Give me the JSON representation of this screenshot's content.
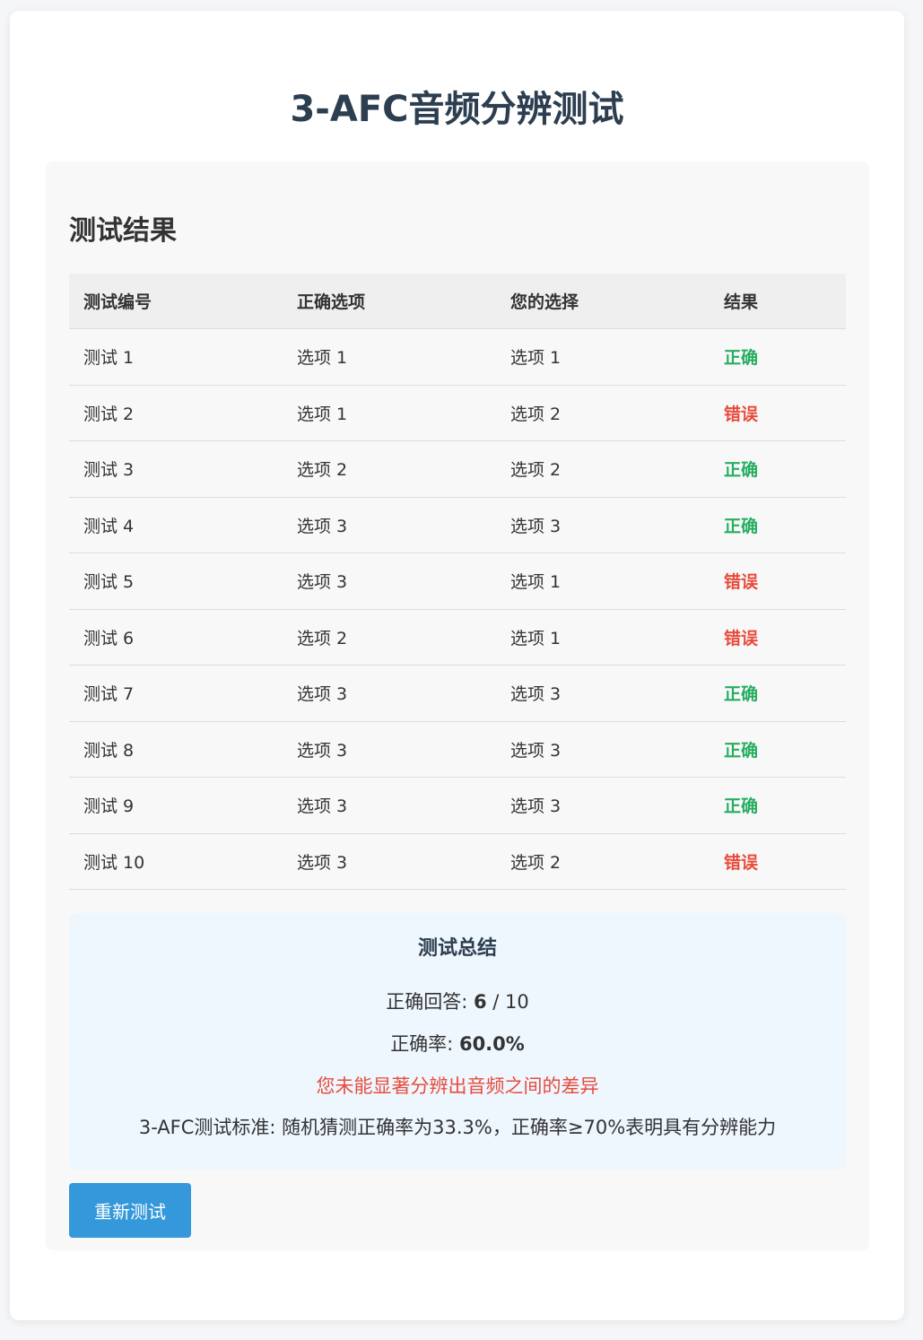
{
  "title": "3-AFC音频分辨测试",
  "results": {
    "heading": "测试结果",
    "columns": [
      "测试编号",
      "正确选项",
      "您的选择",
      "结果"
    ],
    "rows": [
      {
        "test": "测试 1",
        "correct": "选项 1",
        "choice": "选项 1",
        "result": "正确",
        "status": "ok"
      },
      {
        "test": "测试 2",
        "correct": "选项 1",
        "choice": "选项 2",
        "result": "错误",
        "status": "bad"
      },
      {
        "test": "测试 3",
        "correct": "选项 2",
        "choice": "选项 2",
        "result": "正确",
        "status": "ok"
      },
      {
        "test": "测试 4",
        "correct": "选项 3",
        "choice": "选项 3",
        "result": "正确",
        "status": "ok"
      },
      {
        "test": "测试 5",
        "correct": "选项 3",
        "choice": "选项 1",
        "result": "错误",
        "status": "bad"
      },
      {
        "test": "测试 6",
        "correct": "选项 2",
        "choice": "选项 1",
        "result": "错误",
        "status": "bad"
      },
      {
        "test": "测试 7",
        "correct": "选项 3",
        "choice": "选项 3",
        "result": "正确",
        "status": "ok"
      },
      {
        "test": "测试 8",
        "correct": "选项 3",
        "choice": "选项 3",
        "result": "正确",
        "status": "ok"
      },
      {
        "test": "测试 9",
        "correct": "选项 3",
        "choice": "选项 3",
        "result": "正确",
        "status": "ok"
      },
      {
        "test": "测试 10",
        "correct": "选项 3",
        "choice": "选项 2",
        "result": "错误",
        "status": "bad"
      }
    ]
  },
  "summary": {
    "heading": "测试总结",
    "correct_label": "正确回答: ",
    "correct_count": "6",
    "total_suffix": " / 10",
    "rate_label": "正确率: ",
    "rate_value": "60.0%",
    "conclusion": "您未能显著分辨出音频之间的差异",
    "standard": "3-AFC测试标准: 随机猜测正确率为33.3%，正确率≥70%表明具有分辨能力"
  },
  "retest_label": "重新测试",
  "colors": {
    "correct": "#27ae60",
    "wrong": "#e74c3c",
    "button": "#3498db",
    "title": "#2c3e50"
  }
}
